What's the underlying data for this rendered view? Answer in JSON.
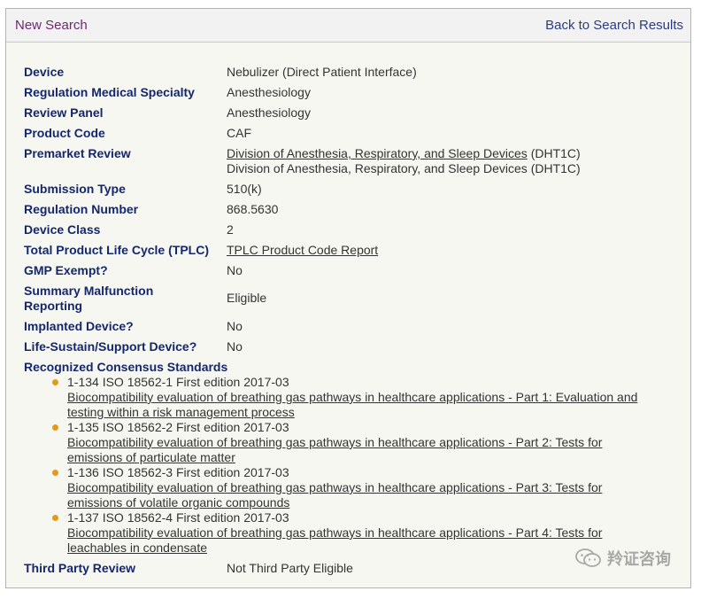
{
  "topbar": {
    "new_search": "New Search",
    "back": "Back to Search Results"
  },
  "fields": {
    "device_label": "Device",
    "device_value": "Nebulizer (Direct Patient Interface)",
    "specialty_label": "Regulation Medical Specialty",
    "specialty_value": "Anesthesiology",
    "panel_label": "Review Panel",
    "panel_value": "Anesthesiology",
    "code_label": "Product Code",
    "code_value": "CAF",
    "premarket_label": "Premarket Review",
    "premarket_line1_link": "Division of Anesthesia, Respiratory, and Sleep Devices",
    "premarket_line1_suffix": " (DHT1C)",
    "premarket_line2": "Division of Anesthesia, Respiratory, and Sleep Devices (DHT1C)",
    "submission_label": "Submission Type",
    "submission_value": "510(k)",
    "regnum_label": "Regulation Number",
    "regnum_value": "868.5630",
    "class_label": "Device Class",
    "class_value": "2",
    "tplc_label": "Total Product Life Cycle (TPLC)",
    "tplc_value": "TPLC Product Code Report",
    "gmp_label": "GMP Exempt?",
    "gmp_value": "No",
    "smr_label_line1": "Summary Malfunction",
    "smr_label_line2": "Reporting",
    "smr_value": "Eligible",
    "implanted_label": "Implanted Device?",
    "implanted_value": "No",
    "lifesustain_label": "Life-Sustain/Support Device?",
    "lifesustain_value": "No",
    "standards_label": "Recognized Consensus Standards",
    "third_party_label": "Third Party Review",
    "third_party_value": "Not Third Party Eligible"
  },
  "standards": [
    {
      "code": "1-134 ISO 18562-1 First edition 2017-03",
      "title_line1": "Biocompatibility evaluation of breathing gas pathways in healthcare applications - Part 1: Evaluation and",
      "title_line2": "testing within a risk management process"
    },
    {
      "code": "1-135 ISO 18562-2 First edition 2017-03",
      "title_line1": "Biocompatibility evaluation of breathing gas pathways in healthcare applications - Part 2: Tests for",
      "title_line2": "emissions of particulate matter"
    },
    {
      "code": "1-136 ISO 18562-3 First edition 2017-03",
      "title_line1": "Biocompatibility evaluation of breathing gas pathways in healthcare applications - Part 3: Tests for",
      "title_line2": "emissions of volatile organic compounds"
    },
    {
      "code": "1-137 ISO 18562-4 First edition 2017-03",
      "title_line1": "Biocompatibility evaluation of breathing gas pathways in healthcare applications - Part 4: Tests for",
      "title_line2": "leachables in condensate"
    }
  ],
  "watermark": {
    "text": "羚证咨询",
    "icon": "wechat-icon"
  },
  "colors": {
    "label": "#14276b",
    "bullet": "#e59a14",
    "new_search": "#6e2a6e",
    "back_link": "#2b3d7f",
    "panel_bg": "#f7f7f2"
  }
}
